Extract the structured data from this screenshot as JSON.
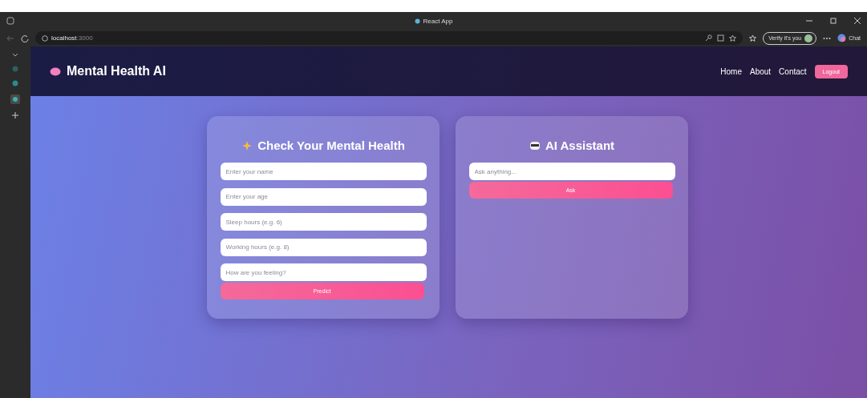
{
  "browser": {
    "tab_title": "React App",
    "url_host": "localhost",
    "url_port": ":3000",
    "verify_label": "Verify it's you",
    "copilot_label": "Chat"
  },
  "navbar": {
    "brand": "Mental Health AI",
    "links": [
      "Home",
      "About",
      "Contact"
    ],
    "logout": "Logout"
  },
  "check_card": {
    "title": "Check Your Mental Health",
    "fields": [
      {
        "placeholder": "Enter your name"
      },
      {
        "placeholder": "Enter your age"
      },
      {
        "placeholder": "Sleep hours (e.g. 6)"
      },
      {
        "placeholder": "Working hours (e.g. 8)"
      },
      {
        "placeholder": "How are you feeling?"
      }
    ],
    "button": "Predict"
  },
  "assistant_card": {
    "title": "AI Assistant",
    "field": {
      "placeholder": "Ask anything..."
    },
    "button": "Ask"
  }
}
